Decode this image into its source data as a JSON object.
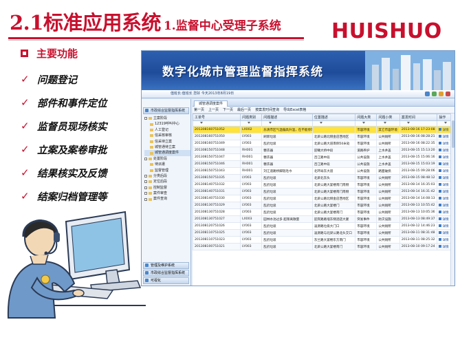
{
  "slide": {
    "title_main": "2.1标准应用系统",
    "title_sub": "1.监督中心受理子系统",
    "brand": "HUISHUO"
  },
  "features": {
    "heading": "主要功能",
    "items": [
      "问题登记",
      "部件和事件定位",
      "监督员现场核实",
      "立案及案卷审批",
      "结果核实及反馈",
      "结案归档管理等"
    ]
  },
  "app": {
    "banner_title": "数字化城市管理监督指挥系统",
    "user_info": "值班长:值班长 您好 今天2013年8月19日",
    "sidebar": {
      "header": "市政综合监督指挥系统",
      "tree": [
        {
          "label": "立案阶段",
          "level": 1
        },
        {
          "label": "12319呼叫中心",
          "level": 2
        },
        {
          "label": "人工登记",
          "level": 2
        },
        {
          "label": "信采核审核",
          "level": 2
        },
        {
          "label": "信采待立案",
          "level": 2
        },
        {
          "label": "城管通待立案",
          "level": 2
        },
        {
          "label": "城管通调度案件",
          "level": 2
        },
        {
          "label": "处置阶段",
          "level": 1
        },
        {
          "label": "待派遣",
          "level": 2
        },
        {
          "label": "监督管理",
          "level": 2
        },
        {
          "label": "分类后段",
          "level": 1
        },
        {
          "label": "定位后段",
          "level": 1
        },
        {
          "label": "控制监督",
          "level": 1
        },
        {
          "label": "案件审查",
          "level": 1
        },
        {
          "label": "案件查询",
          "level": 1
        }
      ],
      "bottom": [
        "管理及维护系统",
        "市政综合监督指挥系统",
        "可视化"
      ]
    },
    "tab_label": "城管通调度案件",
    "toolbar": [
      "第一页",
      "上一页",
      "下一页",
      "最后一页",
      "按案发时间查询",
      "导出Excel表格"
    ],
    "columns": [
      "工单号",
      "问题类别",
      "问题描述",
      "位置描述",
      "问题大类",
      "问题小类",
      "案发时间",
      "操作"
    ],
    "rows": [
      [
        "201308160751052",
        "LX002",
        "乐清市区气温偏高升温，在不能停车于汽车站外门南头",
        "",
        "市容环境",
        "其它市容环境",
        "2013-08-16 17:23:08",
        "详情"
      ],
      [
        "201308160751050",
        "LY003",
        "刷新垃圾",
        "北梁公路北侧金店西地区",
        "市容环境",
        "公共厕所",
        "2013-08-16 08:28:21",
        "详情"
      ],
      [
        "201308160751049",
        "LY003",
        "乱扔垃圾",
        "北梁公路大道南侧50米处",
        "市容环境",
        "公共厕所",
        "2013-08-16 08:22:35",
        "详情"
      ],
      [
        "201308150751048",
        "RH001",
        "糖衣器",
        "迎曦大桥中段",
        "道路养护",
        "上水井盖",
        "2013-08-15 15:13:20",
        "详情"
      ],
      [
        "201308150751047",
        "RH001",
        "糖衣器",
        "吕江路中段",
        "公共设施",
        "上水井盖",
        "2013-08-15 15:06:16",
        "详情"
      ],
      [
        "201308150751046",
        "RH001",
        "糖衣器",
        "吕江路中段",
        "公共设施",
        "上水井盖",
        "2013-08-15 15:03:19",
        "详情"
      ],
      [
        "201308150751043",
        "RH001",
        "刘江道路桥脚链毛巾",
        "北环局东大道",
        "公共设施",
        "路面破损",
        "2013-08-15 09:28:06",
        "详情"
      ],
      [
        "201308150751035",
        "LY003",
        "乱扔垃圾",
        "北梁北东头",
        "市容环境",
        "公共厕所",
        "2013-08-15 08:48:12",
        "详情"
      ],
      [
        "201308140751032",
        "LY003",
        "乱扔垃圾",
        "北梁公路大宴楼南门南侧",
        "市容环境",
        "公共厕所",
        "2013-08-14 16:35:03",
        "详情"
      ],
      [
        "201308140751031",
        "LY003",
        "乱扔垃圾",
        "北梁公路大宴楼南门南侧",
        "市容环境",
        "公共厕所",
        "2013-08-14 16:31:42",
        "详情"
      ],
      [
        "201308140751030",
        "LY003",
        "乱扔垃圾",
        "北梁公路北侧金店西地区",
        "市容环境",
        "公共厕所",
        "2013-08-14 14:08:13",
        "详情"
      ],
      [
        "201308130751029",
        "LY003",
        "乱扔垃圾",
        "北梁公路大宴楼门",
        "市容环境",
        "公共厕所",
        "2013-08-13 10:55:42",
        "详情"
      ],
      [
        "201308130751028",
        "LY003",
        "乱扔垃圾",
        "北梁公路大宴楼南门",
        "市容环境",
        "公共厕所",
        "2013-08-13 10:05:36",
        "详情"
      ],
      [
        "201308130751027",
        "LX003",
        "园林水池过多 超限离散量",
        "迎宾路路墙东侧酒店大厦",
        "突发事件",
        "防灾设施",
        "2013-08-13 08:49:37",
        "详情"
      ],
      [
        "201308120751026",
        "LY003",
        "乱扔垃圾",
        "凌源路垃圾大门口",
        "市容环境",
        "公共厕所",
        "2013-08-12 14:46:23",
        "详情"
      ],
      [
        "201308110751025",
        "LY003",
        "乱扔垃圾",
        "凌源路与北梁公路北头交口",
        "市容环境",
        "公共厕所",
        "2013-08-11 08:31:48",
        "详情"
      ],
      [
        "201308110751023",
        "LY003",
        "乱扔垃圾",
        "东兰路大宴楼东方南门",
        "市容环境",
        "公共厕所",
        "2013-08-11 08:25:32",
        "详情"
      ],
      [
        "201308100751021",
        "LY003",
        "乱扔垃圾",
        "北梁公路大宴楼南门",
        "市容环境",
        "公共厕所",
        "2013-08-10 09:17:24",
        "详情"
      ]
    ]
  },
  "colors": {
    "accent_red": "#c8102e",
    "banner_blue": "#1f4c9a",
    "highlight_row": "#ffe23a"
  }
}
